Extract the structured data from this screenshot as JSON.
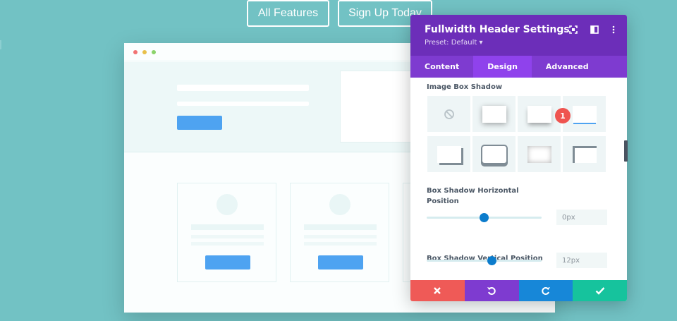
{
  "top_buttons": {
    "features": "All Features",
    "signup": "Sign Up Today"
  },
  "modal": {
    "title": "Fullwidth Header Settings",
    "preset": "Preset: Default ▾",
    "tabs": [
      {
        "label": "Content",
        "active": false
      },
      {
        "label": "Design",
        "active": true
      },
      {
        "label": "Advanced",
        "active": false
      }
    ],
    "sections": {
      "image_box_shadow": "Image Box Shadow",
      "horizontal_label": "Box Shadow Horizontal Position",
      "horizontal_value": "0px",
      "vertical_label": "Box Shadow Vertical Position",
      "vertical_value": "12px"
    },
    "badge": "1",
    "sliders": {
      "horizontal_fraction": 0.5,
      "vertical_fraction": 0.57
    },
    "colors": {
      "header": "#6c2eb9",
      "tabs": "#7e3bd0",
      "active_tab": "#8f42ec",
      "cancel": "#ef5a57",
      "undo": "#7e3bd0",
      "redo": "#1787d8",
      "save": "#16c39d"
    }
  }
}
